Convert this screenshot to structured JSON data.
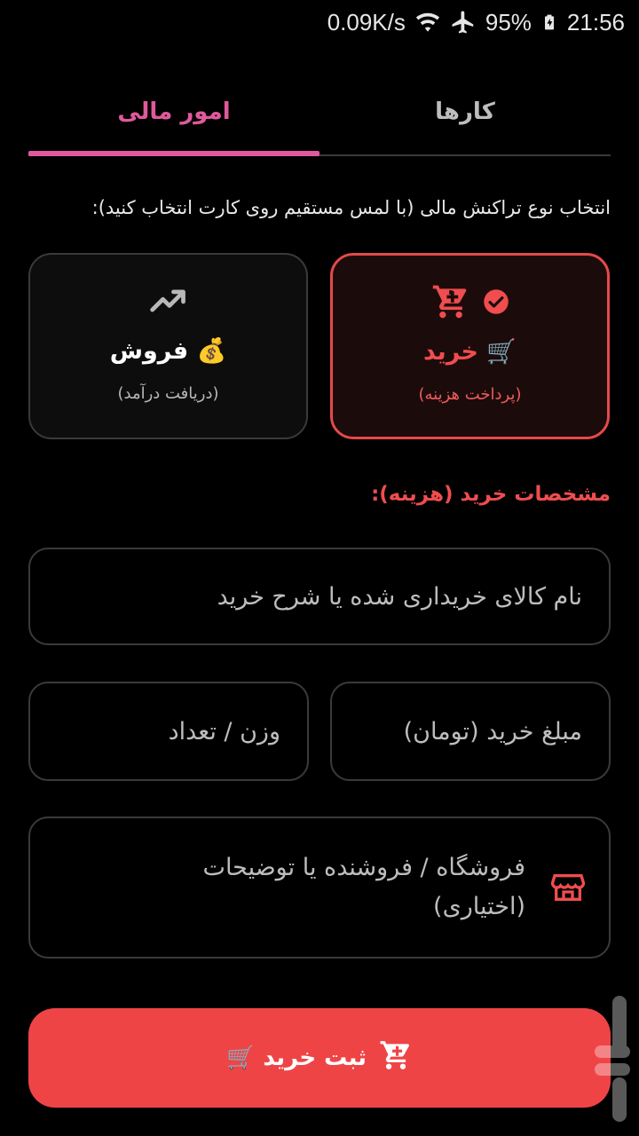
{
  "status": {
    "net_speed": "0.09K/s",
    "battery": "95%",
    "time": "21:56"
  },
  "tabs": [
    {
      "label": "کارها",
      "active": false
    },
    {
      "label": "امور مالی",
      "active": true
    }
  ],
  "instruction": "انتخاب نوع تراکنش مالی (با لمس مستقیم روی کارت انتخاب کنید):",
  "cards": {
    "buy": {
      "title": "🛒 خرید",
      "subtitle": "(پرداخت هزینه)",
      "icon": "cart-icon",
      "selected": true
    },
    "sell": {
      "title": "💰 فروش",
      "subtitle": "(دریافت درآمد)",
      "icon": "trending-up-icon",
      "selected": false
    }
  },
  "section_title": "مشخصات خرید (هزینه):",
  "fields": {
    "name_placeholder": "نام کالای خریداری شده یا شرح خرید",
    "amount_placeholder": "مبلغ خرید (تومان)",
    "weight_placeholder": "وزن / تعداد",
    "store_placeholder": "فروشگاه / فروشنده یا توضیحات (اختیاری)"
  },
  "submit_label": "ثبت خرید 🛒",
  "colors": {
    "accent_pink": "#e0599c",
    "accent_red": "#ef4446",
    "background": "#000000"
  }
}
